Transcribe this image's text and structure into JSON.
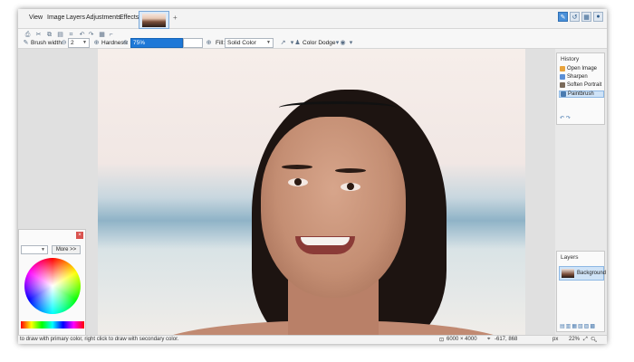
{
  "menu": {
    "items": [
      "View",
      "Image",
      "Layers",
      "Adjustments",
      "Effects"
    ],
    "add_tab": "+"
  },
  "toolbar": {
    "brush_width_label": "Brush width:",
    "brush_width_value": "2",
    "hardness_label": "Hardness:",
    "hardness_value": "75%",
    "fill_label": "Fill:",
    "fill_value": "Solid Color",
    "blend_mode": "Color Dodge"
  },
  "history": {
    "title": "History",
    "items": [
      {
        "label": "Open Image",
        "active": false,
        "color": "#e8a33c"
      },
      {
        "label": "Sharpen",
        "active": false,
        "color": "#5b8fd6"
      },
      {
        "label": "Soften Portrait",
        "active": false,
        "color": "#7a6a5a"
      },
      {
        "label": "Paintbrush",
        "active": true,
        "color": "#4a7bb0"
      }
    ]
  },
  "layers": {
    "title": "Layers",
    "items": [
      {
        "label": "Background"
      }
    ]
  },
  "colors": {
    "more_label": "More >>"
  },
  "status": {
    "hint": "to draw with primary color, right click to draw with secondary color.",
    "image_size": "6000 × 4000",
    "cursor_pos": "-617, 868",
    "units": "px",
    "zoom": "22%"
  }
}
